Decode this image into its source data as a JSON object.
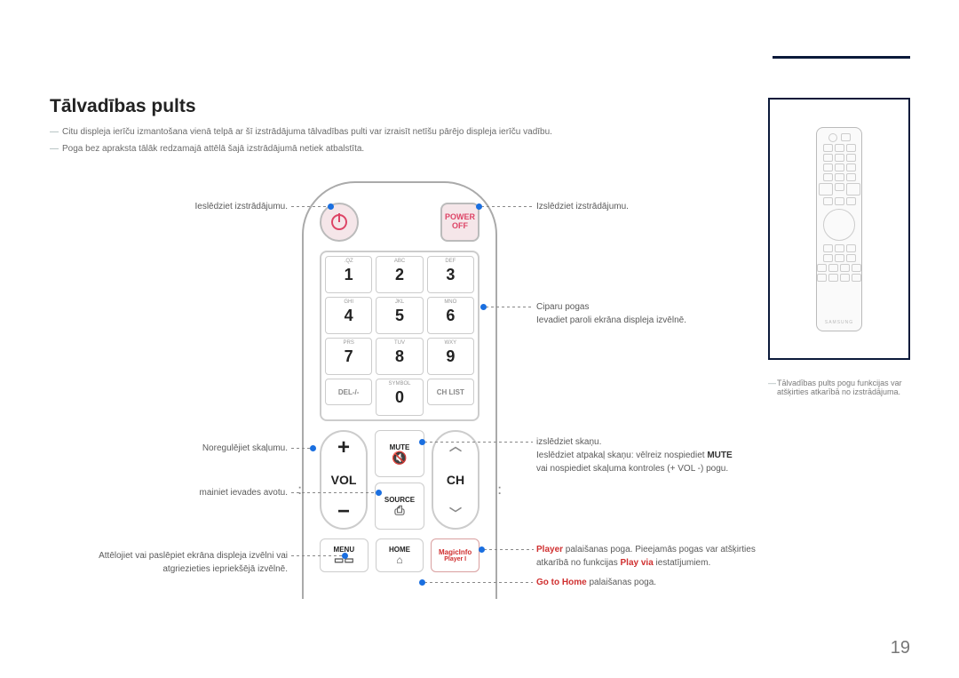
{
  "title": "Tālvadības pults",
  "notes": [
    "Citu displeja ierīču izmantošana vienā telpā ar šī izstrādājuma tālvadības pulti var izraisīt netīšu pārējo displeja ierīču vadību.",
    "Poga bez apraksta tālāk redzamajā attēlā šajā izstrādājumā netiek atbalstīta."
  ],
  "side_note": "Tālvadības pults pogu funkcijas var atšķirties atkarībā no izstrādājuma.",
  "mini_brand": "SAMSUNG",
  "remote": {
    "power_off_line1": "POWER",
    "power_off_line2": "OFF",
    "keys": [
      {
        "sub": ".QZ",
        "n": "1"
      },
      {
        "sub": "ABC",
        "n": "2"
      },
      {
        "sub": "DEF",
        "n": "3"
      },
      {
        "sub": "GHI",
        "n": "4"
      },
      {
        "sub": "JKL",
        "n": "5"
      },
      {
        "sub": "MNO",
        "n": "6"
      },
      {
        "sub": "PRS",
        "n": "7"
      },
      {
        "sub": "TUV",
        "n": "8"
      },
      {
        "sub": "WXY",
        "n": "9"
      }
    ],
    "row4": [
      "DEL-/-",
      "SYMBOL",
      "CH LIST"
    ],
    "key0": {
      "sub": "SYMBOL",
      "n": "0"
    },
    "vol_label": "VOL",
    "ch_label": "CH",
    "mute": "MUTE",
    "source": "SOURCE",
    "menu": "MENU",
    "home": "HOME",
    "magic1": "MagicInfo",
    "magic2": "Player I"
  },
  "callouts": {
    "power_on": "Ieslēdziet izstrādājumu.",
    "power_off": "Izslēdziet izstrādājumu.",
    "digits_title": "Ciparu pogas",
    "digits_body": "Ievadiet paroli ekrāna displeja izvēlnē.",
    "vol": "Noregulējiet skaļumu.",
    "source": "mainiet ievades avotu.",
    "mute_title": "izslēdziet skaņu.",
    "mute_l1_pre": "Ieslēdziet atpakaļ skaņu: vēlreiz nospiediet ",
    "mute_l1_bold": "MUTE",
    "mute_l2": "vai nospiediet skaļuma kontroles (+ VOL -) pogu.",
    "menu": "Attēlojiet vai paslēpiet ekrāna displeja izvēlni vai atgriezieties iepriekšējā izvēlnē.",
    "player_pre": "Player",
    "player_mid": " palaišanas poga. Pieejamās pogas var atšķirties atkarībā no funkcijas ",
    "player_bold": "Play via",
    "player_end": " iestatījumiem.",
    "home_pre": "Go to Home",
    "home_end": " palaišanas poga."
  },
  "page_number": "19"
}
